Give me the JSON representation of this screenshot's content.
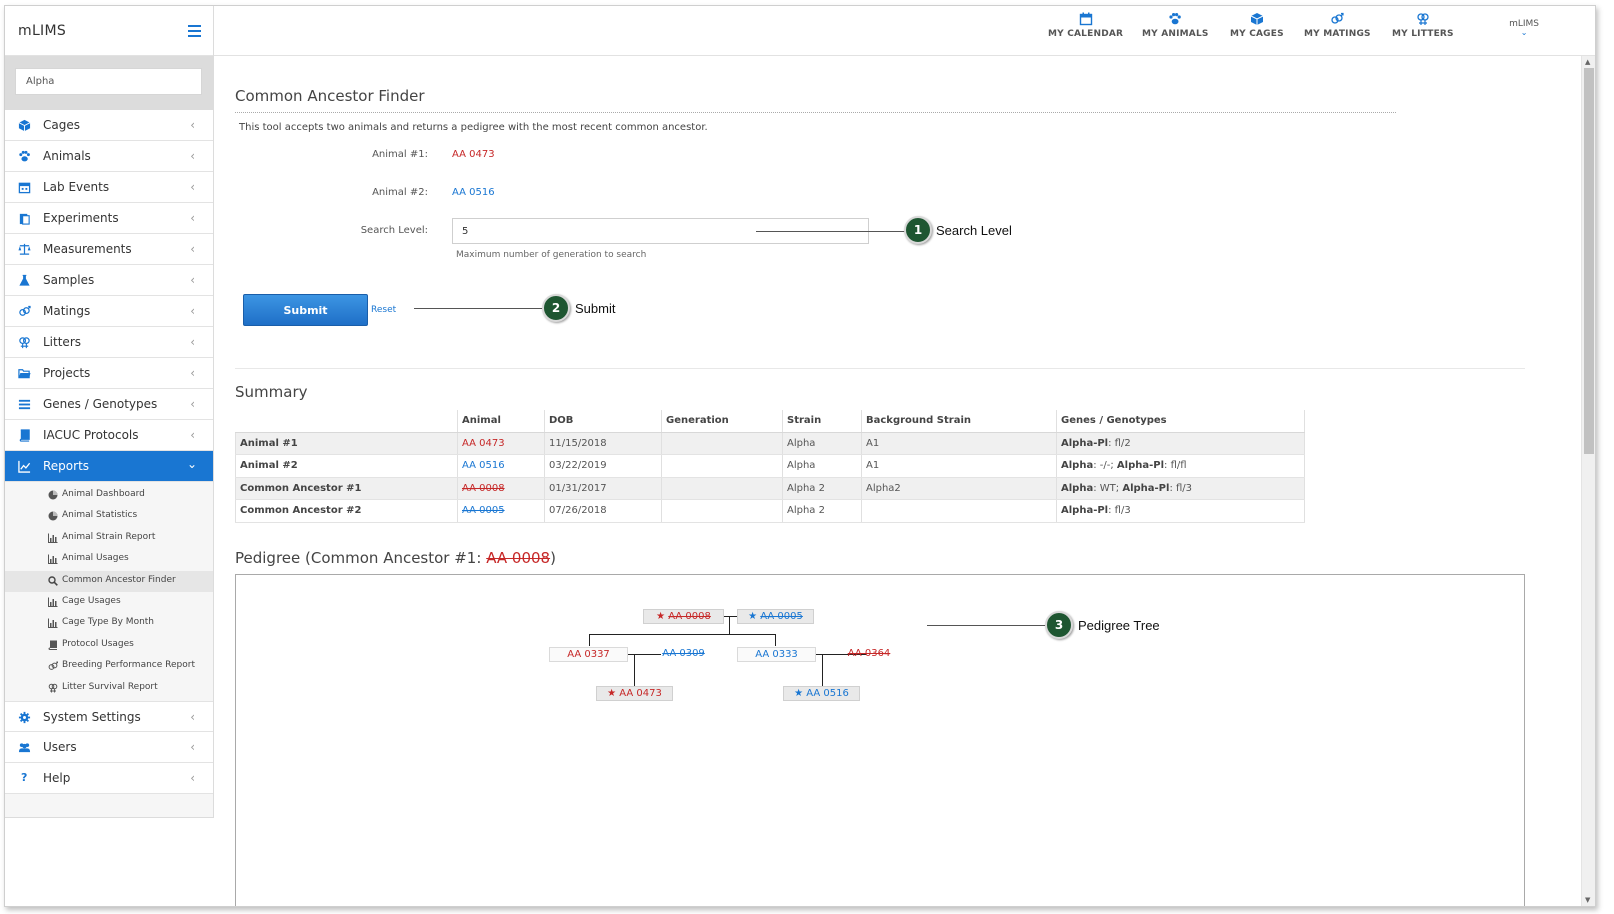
{
  "app": {
    "brand": "mLIMS",
    "user": "mLIMS"
  },
  "sidebar": {
    "search_value": "Alpha",
    "items": [
      {
        "label": "Cages",
        "icon": "cube-icon"
      },
      {
        "label": "Animals",
        "icon": "paw-icon"
      },
      {
        "label": "Lab Events",
        "icon": "calendar-icon"
      },
      {
        "label": "Experiments",
        "icon": "clipboard-icon"
      },
      {
        "label": "Measurements",
        "icon": "scale-icon"
      },
      {
        "label": "Samples",
        "icon": "flask-icon"
      },
      {
        "label": "Matings",
        "icon": "mating-icon"
      },
      {
        "label": "Litters",
        "icon": "litter-icon"
      },
      {
        "label": "Projects",
        "icon": "folder-icon"
      },
      {
        "label": "Genes / Genotypes",
        "icon": "list-icon"
      },
      {
        "label": "IACUC Protocols",
        "icon": "book-icon"
      },
      {
        "label": "Reports",
        "icon": "chart-icon"
      }
    ],
    "report_subitems": [
      {
        "label": "Animal Dashboard",
        "icon": "pie-icon"
      },
      {
        "label": "Animal Statistics",
        "icon": "pie-icon"
      },
      {
        "label": "Animal Strain Report",
        "icon": "bar-chart-icon"
      },
      {
        "label": "Animal Usages",
        "icon": "bar-chart-icon"
      },
      {
        "label": "Common Ancestor Finder",
        "icon": "search-icon"
      },
      {
        "label": "Cage Usages",
        "icon": "bar-chart-icon"
      },
      {
        "label": "Cage Type By Month",
        "icon": "bar-chart-icon"
      },
      {
        "label": "Protocol Usages",
        "icon": "book-icon"
      },
      {
        "label": "Breeding Performance Report",
        "icon": "mating-icon"
      },
      {
        "label": "Litter Survival Report",
        "icon": "litter-icon"
      }
    ],
    "bottom_items": [
      {
        "label": "System Settings",
        "icon": "gear-icon"
      },
      {
        "label": "Users",
        "icon": "users-icon"
      },
      {
        "label": "Help",
        "icon": "question-icon"
      }
    ]
  },
  "topbar": {
    "links": [
      {
        "label": "MY CALENDAR",
        "icon": "calendar-icon"
      },
      {
        "label": "MY ANIMALS",
        "icon": "paw-icon"
      },
      {
        "label": "MY CAGES",
        "icon": "cube-icon"
      },
      {
        "label": "MY MATINGS",
        "icon": "mating-icon"
      },
      {
        "label": "MY LITTERS",
        "icon": "litter-icon"
      }
    ]
  },
  "form": {
    "title": "Common Ancestor Finder",
    "description": "This tool accepts two animals and returns a pedigree with the most recent common ancestor.",
    "animal1_label": "Animal #1:",
    "animal1_value": "AA 0473",
    "animal2_label": "Animal #2:",
    "animal2_value": "AA 0516",
    "level_label": "Search Level:",
    "level_value": "5",
    "level_help": "Maximum number of generation to search",
    "submit_label": "Submit",
    "reset_label": "Reset"
  },
  "summary": {
    "title": "Summary",
    "headers": [
      "",
      "Animal",
      "DOB",
      "Generation",
      "Strain",
      "Background Strain",
      "Genes / Genotypes"
    ],
    "rows": [
      {
        "label": "Animal #1",
        "animal": "AA 0473",
        "dob": "11/15/2018",
        "generation": "",
        "strain": "Alpha",
        "background": "A1",
        "genes": [
          {
            "name": "Alpha-Pl",
            "value": "fl/2"
          }
        ]
      },
      {
        "label": "Animal #2",
        "animal": "AA 0516",
        "dob": "03/22/2019",
        "generation": "",
        "strain": "Alpha",
        "background": "A1",
        "genes": [
          {
            "name": "Alpha",
            "value": "-/-"
          },
          {
            "name": "Alpha-Pl",
            "value": "fl/fl"
          }
        ]
      },
      {
        "label": "Common Ancestor #1",
        "animal": "AA 0008",
        "dob": "01/31/2017",
        "generation": "",
        "strain": "Alpha 2",
        "background": "Alpha2",
        "genes": [
          {
            "name": "Alpha",
            "value": "WT"
          },
          {
            "name": "Alpha-Pl",
            "value": "fl/3"
          }
        ]
      },
      {
        "label": "Common Ancestor #2",
        "animal": "AA 0005",
        "dob": "07/26/2018",
        "generation": "",
        "strain": "Alpha 2",
        "background": "",
        "genes": [
          {
            "name": "Alpha-Pl",
            "value": "fl/3"
          }
        ]
      }
    ]
  },
  "pedigree": {
    "title_prefix": "Pedigree (Common Ancestor #1: ",
    "title_id": "AA 0008",
    "title_suffix": ")",
    "nodes": {
      "ca1": "AA 0008",
      "ca2": "AA 0005",
      "n0337": "AA 0337",
      "n0309": "AA 0309",
      "n0333": "AA 0333",
      "n0364": "AA 0364",
      "n0473": "AA 0473",
      "n0516": "AA 0516"
    }
  },
  "callouts": [
    {
      "number": "1",
      "text": "Search Level"
    },
    {
      "number": "2",
      "text": "Submit"
    },
    {
      "number": "3",
      "text": "Pedigree Tree"
    }
  ],
  "colors": {
    "accent": "#1976d2",
    "female": "#c62828",
    "male": "#1976d2",
    "badge": "#1e5631"
  }
}
